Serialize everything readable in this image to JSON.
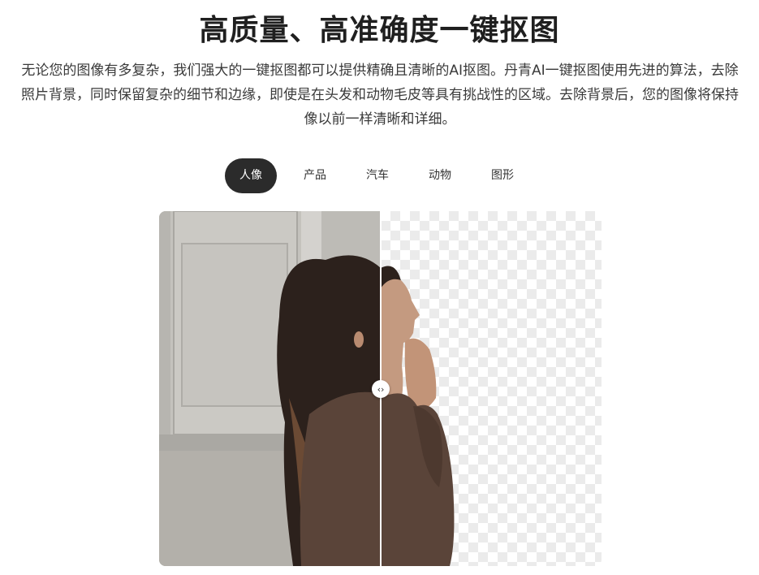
{
  "header": {
    "title": "高质量、高准确度一键抠图",
    "description": "无论您的图像有多复杂，我们强大的一键抠图都可以提供精确且清晰的AI抠图。丹青AI一键抠图使用先进的算法，去除照片背景，同时保留复杂的细节和边缘，即使是在头发和动物毛皮等具有挑战性的区域。去除背景后，您的图像将保持像以前一样清晰和详细。"
  },
  "tabs": [
    {
      "label": "人像",
      "active": true
    },
    {
      "label": "产品",
      "active": false
    },
    {
      "label": "汽车",
      "active": false
    },
    {
      "label": "动物",
      "active": false
    },
    {
      "label": "图形",
      "active": false
    }
  ],
  "compare": {
    "handle_glyph": "‹›",
    "split_fraction": 0.5,
    "checker_color": "#ebebeb",
    "active_tab_color": "#2b2b2b"
  }
}
